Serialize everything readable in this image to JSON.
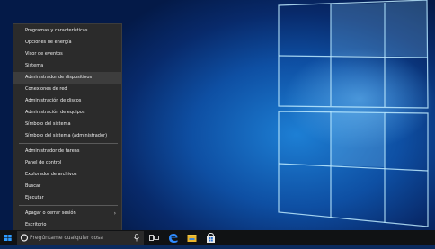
{
  "context_menu": {
    "items": [
      {
        "label": "Programas y características"
      },
      {
        "label": "Opciones de energía"
      },
      {
        "label": "Visor de eventos"
      },
      {
        "label": "Sistema"
      },
      {
        "label": "Administrador de dispositivos"
      },
      {
        "label": "Conexiones de red"
      },
      {
        "label": "Administración de discos"
      },
      {
        "label": "Administración de equipos"
      },
      {
        "label": "Símbolo del sistema"
      },
      {
        "label": "Símbolo del sistema (administrador)"
      },
      {
        "label": "Administrador de tareas"
      },
      {
        "label": "Panel de control"
      },
      {
        "label": "Explorador de archivos"
      },
      {
        "label": "Buscar"
      },
      {
        "label": "Ejecutar"
      },
      {
        "label": "Apagar o cerrar sesión"
      },
      {
        "label": "Escritorio"
      }
    ],
    "highlighted_index": 4
  },
  "taskbar": {
    "search_placeholder": "Pregúntame cualquier cosa",
    "icons": [
      "windows-start-icon",
      "cortana-circle-icon",
      "microphone-icon",
      "task-view-icon",
      "edge-icon",
      "file-explorer-icon",
      "store-icon"
    ]
  },
  "colors": {
    "menu_bg": "#2b2b2b",
    "taskbar_bg": "#101214",
    "accent": "#1d7fd4"
  }
}
